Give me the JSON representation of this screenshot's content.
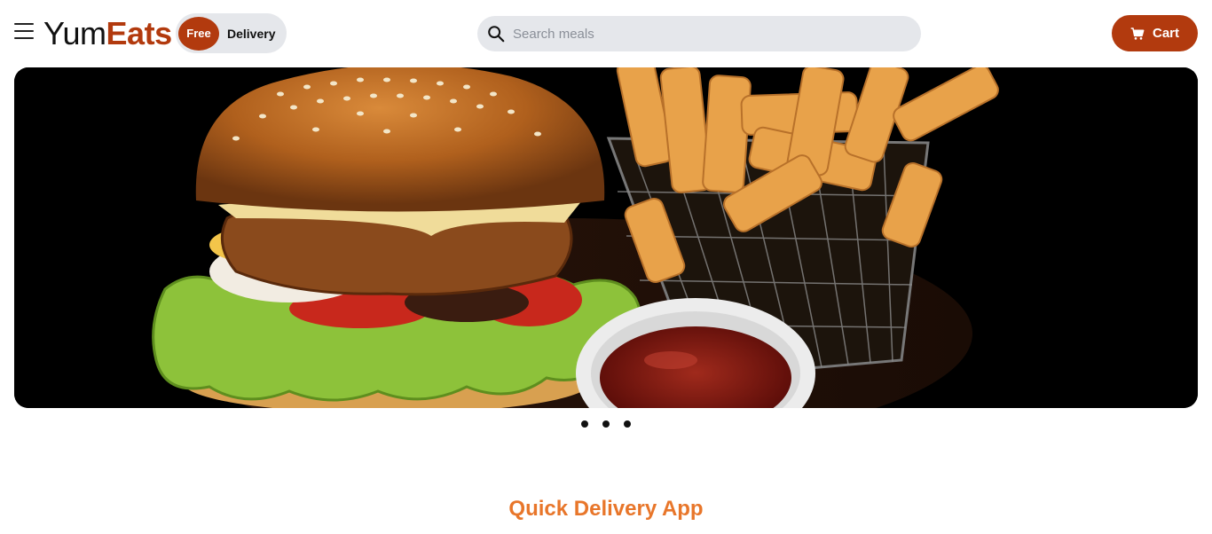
{
  "header": {
    "logo": {
      "part1": "Yum",
      "part2": "Eats"
    },
    "badge": {
      "circle_text": "Free",
      "label": "Delivery"
    },
    "search": {
      "placeholder": "Search meals",
      "value": ""
    },
    "cart": {
      "label": "Cart"
    },
    "icons": {
      "menu": "hamburger-menu-icon",
      "search": "search-icon",
      "cart": "shopping-cart-icon"
    }
  },
  "hero": {
    "image": "burger-and-fries-photo",
    "carousel": {
      "slide_count": 3,
      "active_index": 0
    }
  },
  "main": {
    "section_title": "Quick Delivery App"
  },
  "colors": {
    "brand": "#b23a0e",
    "accent": "#e8762a",
    "pill_bg": "#e5e7eb"
  }
}
